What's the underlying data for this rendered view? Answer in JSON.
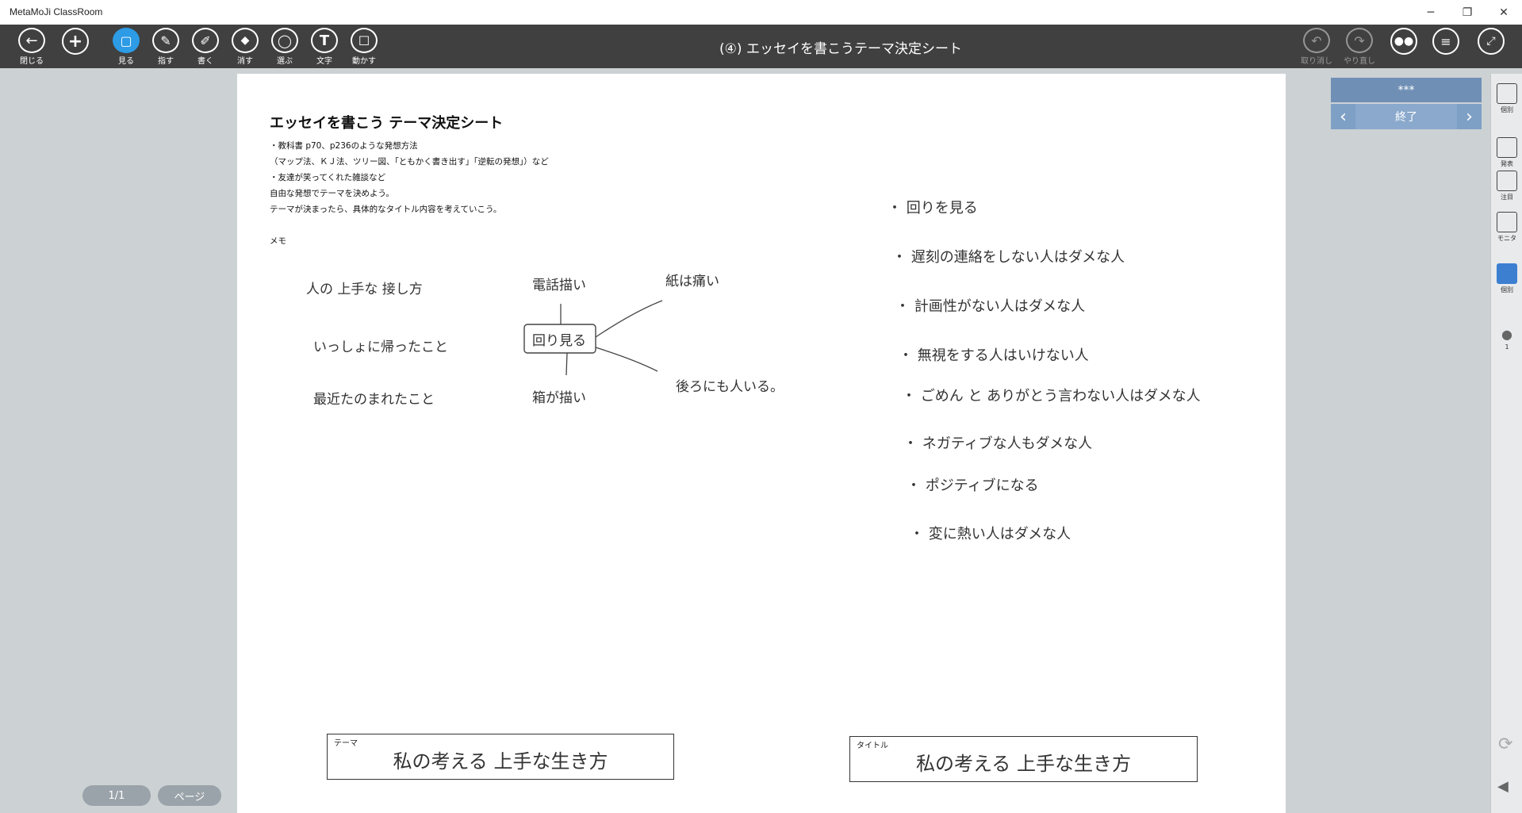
{
  "window": {
    "app_title": "MetaMoJi ClassRoom",
    "minimize": "─",
    "restore": "❐",
    "close": "✕"
  },
  "toolbar": {
    "left_tools": [
      {
        "label": "閉じる",
        "glyph": "←"
      },
      {
        "label": "",
        "glyph": "+"
      },
      {
        "label": "見る",
        "glyph": "▢"
      },
      {
        "label": "指す",
        "glyph": "✎"
      },
      {
        "label": "書く",
        "glyph": "✐"
      },
      {
        "label": "消す",
        "glyph": "◆"
      },
      {
        "label": "選ぶ",
        "glyph": "◯"
      },
      {
        "label": "文字",
        "glyph": "T"
      },
      {
        "label": "動かす",
        "glyph": "☐"
      }
    ],
    "doc_title": "(④) エッセイを書こうテーマ決定シート",
    "undo_label": "取り消し",
    "redo_label": "やり直し"
  },
  "page": {
    "heading": "エッセイを書こう テーマ決定シート",
    "lines": [
      "・教科書 p70、p236のような発想方法",
      "（マップ法、ＫＪ法、ツリー図、「ともかく書き出す」「逆転の発想」）など",
      "・友達が笑ってくれた雑談など",
      "自由な発想でテーマを決めよう。",
      "テーマが決まったら、具体的なタイトル内容を考えていこう。"
    ],
    "memo_label": "メモ",
    "mindmap": {
      "left": [
        "人の 上手な 接し方",
        "いっしょに帰ったこと",
        "最近たのまれたこと"
      ],
      "center": "回り見る",
      "top": "電話描い",
      "bottom": "箱が描い",
      "right_top": "紙は痛い",
      "right_bottom": "後ろにも人いる。"
    },
    "notes": [
      "・ 回りを見る",
      "・ 遅刻の連絡をしない人はダメな人",
      "・ 計画性がない人はダメな人",
      "・ 無視をする人はいけない人",
      "・ ごめん と ありがとう言わない人はダメな人",
      "・ ネガティブな人もダメな人",
      "・ ポジティブになる",
      "・ 変に熱い人はダメな人"
    ],
    "theme_box": {
      "caption": "テーマ",
      "value": "私の考える 上手な生き方"
    },
    "title_box": {
      "caption": "タイトル",
      "value": "私の考える 上手な生き方"
    }
  },
  "side_panel": {
    "top_label": "***",
    "end_label": "終了",
    "prev": "‹",
    "next": "›"
  },
  "right_bar": [
    {
      "label": "個別"
    },
    {
      "label": "発表"
    },
    {
      "label": "注目"
    },
    {
      "label": "モニタ"
    },
    {
      "label": "個別"
    },
    {
      "label": "1"
    }
  ],
  "footer": {
    "page_indicator": "1/1",
    "page_button": "ページ"
  }
}
